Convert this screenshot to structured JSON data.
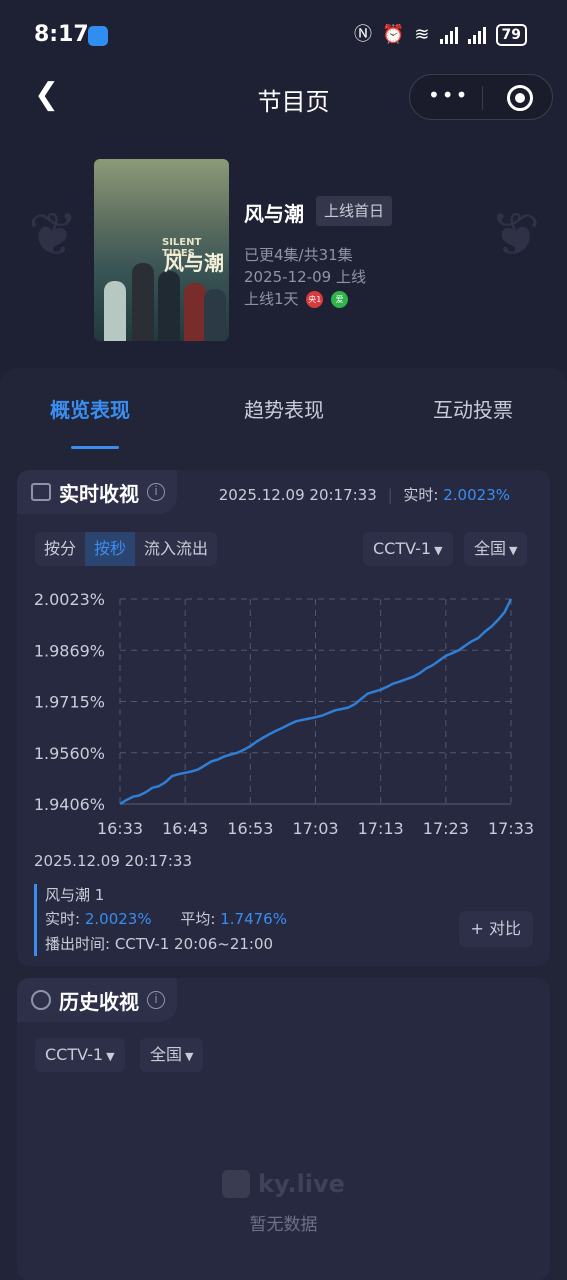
{
  "status_bar": {
    "time": "8:17",
    "battery": "79"
  },
  "nav": {
    "title": "节目页",
    "more": "•••"
  },
  "show": {
    "poster_title_en": "SILENT TIDES",
    "poster_title_cn": "风与潮",
    "title": "风与潮",
    "tag": "上线首日",
    "episodes": "已更4集/共31集",
    "date": "2025-12-09 上线",
    "days": "上线1天",
    "channel_badges": [
      "央1",
      "爱"
    ]
  },
  "tabs": [
    "概览表现",
    "趋势表现",
    "互动投票"
  ],
  "realtime": {
    "title": "实时收视",
    "info": "i",
    "timestamp": "2025.12.09 20:17:33",
    "rt_label": "实时:",
    "rt_value": "2.0023%",
    "modes": [
      "按分",
      "按秒",
      "流入流出"
    ],
    "channel": "CCTV-1",
    "region": "全国",
    "caret": "▼"
  },
  "chart_data": {
    "type": "line",
    "x_ticks": [
      "16:33",
      "16:43",
      "16:53",
      "17:03",
      "17:13",
      "17:23",
      "17:33"
    ],
    "y_ticks": [
      "2.0023%",
      "1.9869%",
      "1.9715%",
      "1.9560%",
      "1.9406%"
    ],
    "ylim": [
      1.9406,
      2.0023
    ],
    "grid": true,
    "color": "#2f7fd6",
    "series": [
      {
        "x": [
          0,
          1,
          2,
          3,
          4,
          5,
          6,
          7,
          8,
          9,
          10,
          11,
          12,
          13,
          14,
          15,
          16,
          17,
          18,
          19,
          20,
          21,
          22,
          23,
          24,
          25,
          26,
          27,
          28,
          29,
          30,
          31,
          32,
          33,
          34,
          35,
          36,
          37,
          38,
          39,
          40,
          41,
          42,
          43,
          44,
          45,
          46,
          47,
          48,
          49,
          50,
          51,
          52,
          53,
          54,
          55,
          56,
          57,
          58,
          59,
          60
        ],
        "values": [
          1.9406,
          1.9418,
          1.9428,
          1.9432,
          1.9442,
          1.9455,
          1.946,
          1.9472,
          1.949,
          1.9496,
          1.95,
          1.9504,
          1.951,
          1.9522,
          1.9534,
          1.954,
          1.9549,
          1.9555,
          1.956,
          1.9569,
          1.958,
          1.9594,
          1.9606,
          1.9617,
          1.9627,
          1.9636,
          1.9646,
          1.9655,
          1.9659,
          1.9663,
          1.9667,
          1.9672,
          1.968,
          1.9688,
          1.9692,
          1.9696,
          1.9706,
          1.9722,
          1.9738,
          1.9744,
          1.975,
          1.9759,
          1.9769,
          1.9775,
          1.9782,
          1.9789,
          1.98,
          1.9814,
          1.9824,
          1.9838,
          1.9852,
          1.986,
          1.9869,
          1.9883,
          1.9896,
          1.9906,
          1.9925,
          1.994,
          1.996,
          1.9983,
          2.0023
        ]
      }
    ]
  },
  "detail": {
    "timestamp": "2025.12.09 20:17:33",
    "name": "风与潮 1",
    "rt_label": "实时:",
    "rt_value": "2.0023%",
    "avg_label": "平均:",
    "avg_value": "1.7476%",
    "broadcast": "播出时间:  CCTV-1 20:06~21:00",
    "compare": "+ 对比"
  },
  "history": {
    "title": "历史收视",
    "info": "i",
    "channel": "CCTV-1",
    "region": "全国",
    "caret": "▼",
    "watermark": "ky.live",
    "empty": "暂无数据"
  }
}
